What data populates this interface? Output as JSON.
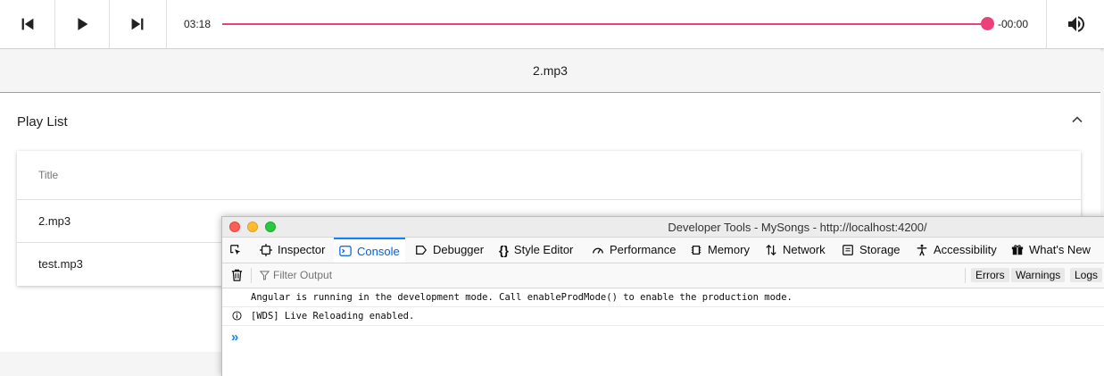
{
  "player": {
    "current_time": "03:18",
    "remaining_time": "-00:00",
    "progress_percent": 100,
    "accent_color": "#ec407a",
    "icons": [
      "skip-previous-icon",
      "play-icon",
      "skip-next-icon",
      "volume-icon"
    ]
  },
  "now_playing": {
    "title": "2.mp3"
  },
  "playlist": {
    "title": "Play List",
    "column_title": "Title",
    "rows": [
      "2.mp3",
      "test.mp3"
    ]
  },
  "devtools": {
    "window_title": "Developer Tools - MySongs - http://localhost:4200/",
    "tabs": [
      "Inspector",
      "Console",
      "Debugger",
      "Style Editor",
      "Performance",
      "Memory",
      "Network",
      "Storage",
      "Accessibility",
      "What's New"
    ],
    "active_tab": "Console",
    "filter_placeholder": "Filter Output",
    "filter_buttons": [
      "Errors",
      "Warnings",
      "Logs"
    ],
    "messages": [
      "Angular is running in the development mode. Call enableProdMode() to enable the production mode.",
      "[WDS] Live Reloading enabled."
    ],
    "prompt_symbol": "»",
    "accent_color": "#0a84ff"
  }
}
